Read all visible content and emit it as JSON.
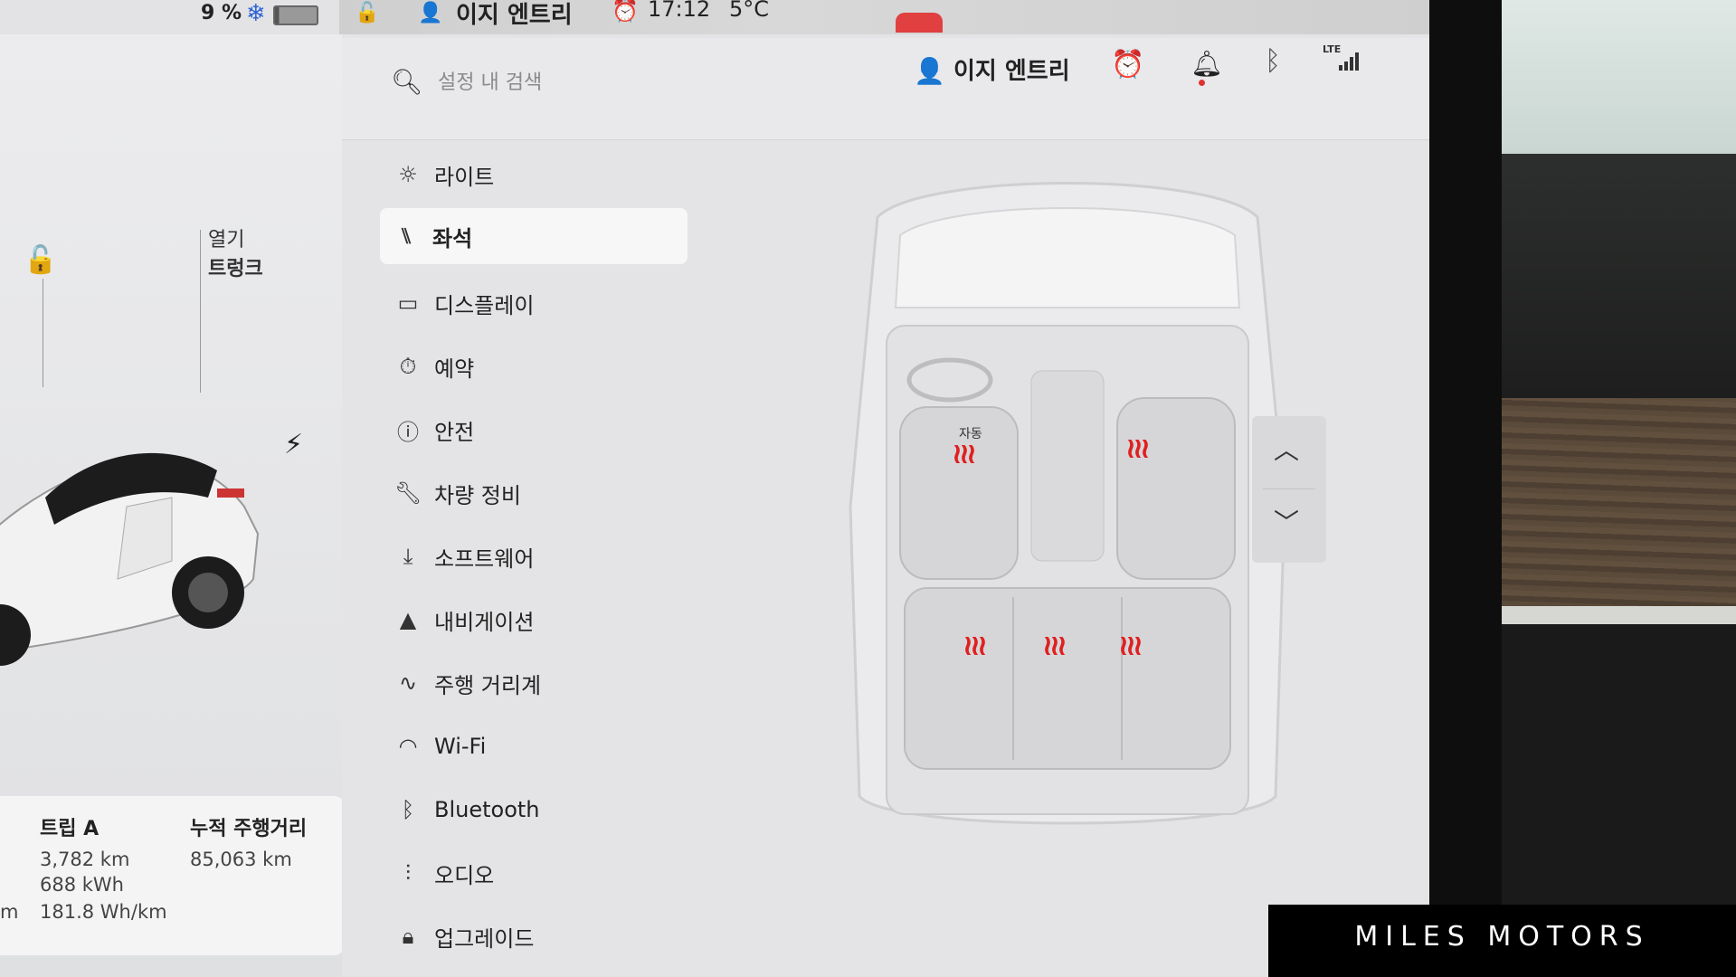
{
  "status": {
    "battery_text": "9 %",
    "snowflake_icon": "snowflake-icon",
    "profile": "이지 엔트리",
    "time": "17:12",
    "temperature": "5°C"
  },
  "left": {
    "trunk_label_1": "열기",
    "trunk_label_2": "트렁크",
    "trip": {
      "title": "트립 A",
      "distance": "3,782 km",
      "energy": "688 kWh",
      "efficiency": "181.8 Wh/km",
      "edge_unit": "m"
    },
    "odometer": {
      "title": "누적 주행거리",
      "value": "85,063 km"
    }
  },
  "search": {
    "placeholder": "설정 내 검색"
  },
  "header": {
    "profile_name": "이지 엔트리",
    "lte_label": "LTE"
  },
  "menu": [
    {
      "label": "라이트",
      "icon": "sun-icon"
    },
    {
      "label": "좌석",
      "icon": "seat-icon",
      "active": true
    },
    {
      "label": "디스플레이",
      "icon": "display-icon"
    },
    {
      "label": "예약",
      "icon": "schedule-icon"
    },
    {
      "label": "안전",
      "icon": "safety-icon"
    },
    {
      "label": "차량 정비",
      "icon": "wrench-icon"
    },
    {
      "label": "소프트웨어",
      "icon": "download-icon"
    },
    {
      "label": "내비게이션",
      "icon": "navigation-icon"
    },
    {
      "label": "주행 거리계",
      "icon": "trip-icon"
    },
    {
      "label": "Wi-Fi",
      "icon": "wifi-icon"
    },
    {
      "label": "Bluetooth",
      "icon": "bluetooth-icon"
    },
    {
      "label": "오디오",
      "icon": "audio-icon"
    },
    {
      "label": "업그레이드",
      "icon": "upgrade-icon"
    }
  ],
  "seats": {
    "driver_auto_label": "자동",
    "heat_color": "#e02020"
  },
  "watermark": "MILES MOTORS"
}
